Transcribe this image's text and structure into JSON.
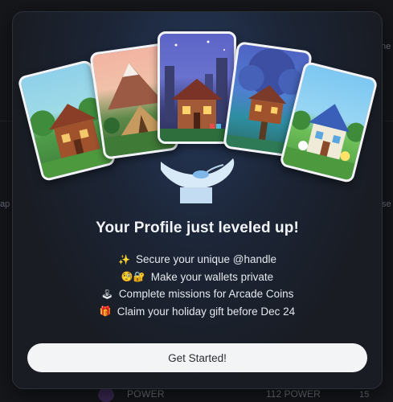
{
  "modal": {
    "title": "Your Profile just leveled up!",
    "features": [
      {
        "icon": "✨",
        "icon_name": "sparkles-icon",
        "text": "Secure your unique @handle"
      },
      {
        "icon": "🧐🔐",
        "icon_name": "lock-icon",
        "text": "Make your wallets private"
      },
      {
        "icon": "🕹",
        "icon_name": "joystick-icon",
        "text": "Complete missions for Arcade Coins"
      },
      {
        "icon": "🎁",
        "icon_name": "gift-icon",
        "text": "Claim your holiday gift before Dec 24"
      }
    ],
    "cta_label": "Get Started!"
  },
  "background": {
    "fragments": [
      "ne",
      "ap",
      "se",
      "POWER",
      "112 POWER",
      "15"
    ]
  },
  "colors": {
    "modal_bg": "#1c2536",
    "cta_bg": "#f3f4f6",
    "title_color": "#f1f3f6"
  }
}
